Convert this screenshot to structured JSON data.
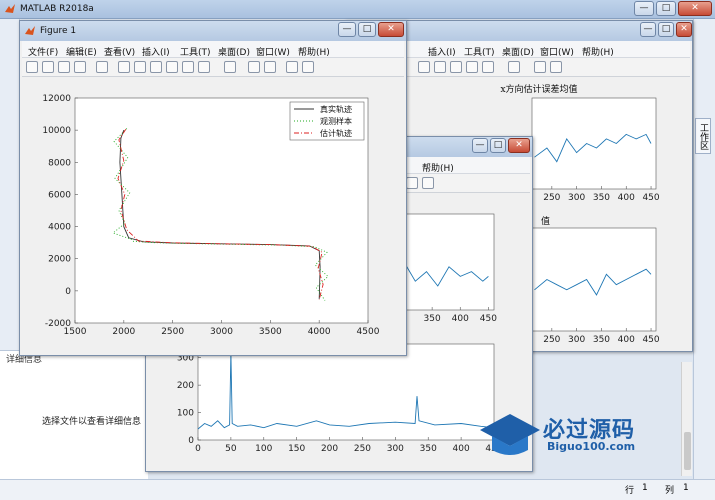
{
  "app": {
    "title": "MATLAB R2018a",
    "right_tab": "工作区",
    "detail_header": "详细信息",
    "detail_text": "选择文件以查看详细信息",
    "status": {
      "row_label": "行",
      "row_value": "1",
      "col_label": "列",
      "col_value": "1"
    },
    "window_controls": [
      "—",
      "□",
      "✕"
    ]
  },
  "menu": [
    "文件(F)",
    "编辑(E)",
    "查看(V)",
    "插入(I)",
    "工具(T)",
    "桌面(D)",
    "窗口(W)",
    "帮助(H)"
  ],
  "menu_help_only": "帮助(H)",
  "figure1": {
    "title": "Figure 1"
  },
  "figure_back": {
    "menu_visible": [
      "插入(I)",
      "工具(T)",
      "桌面(D)",
      "窗口(W)",
      "帮助(H)"
    ],
    "title_fragment": "值"
  },
  "colors": {
    "line_blue": "#1f77b4",
    "true_track": "#333333",
    "observed": "#22aa22",
    "estimate": "#dd2222",
    "watermark": "#1f5fa8"
  },
  "watermark": {
    "cn": "必过源码",
    "en": "Biguo100.com"
  },
  "chart_data": [
    {
      "type": "line",
      "title": "",
      "xlim": [
        1500,
        4500
      ],
      "ylim": [
        -2000,
        12000
      ],
      "xticks": [
        "1500",
        "2000",
        "2500",
        "3000",
        "3500",
        "4000",
        "4500"
      ],
      "yticks": [
        "-2000",
        "0",
        "2000",
        "4000",
        "6000",
        "8000",
        "10000",
        "12000"
      ],
      "legend": {
        "placement": "top-right",
        "entries": [
          "真实轨迹",
          "观测样本",
          "估计轨迹"
        ]
      },
      "series": [
        {
          "name": "真实轨迹",
          "style": "solid",
          "x": [
            2000,
            1970,
            1960,
            1980,
            2000,
            2050,
            2200,
            2500,
            3000,
            3500,
            3900,
            4000,
            4010,
            4005,
            4000
          ],
          "y": [
            10000,
            9500,
            8000,
            6000,
            4000,
            3300,
            3050,
            2980,
            2930,
            2880,
            2800,
            2500,
            1500,
            500,
            -500
          ]
        },
        {
          "name": "观测样本",
          "style": "dotted",
          "x": [
            2030,
            1900,
            2040,
            1910,
            2060,
            1950,
            2010,
            1890,
            2080,
            2100,
            2300,
            2600,
            3100,
            3600,
            3950,
            4080,
            3960,
            4090,
            3970,
            4060
          ],
          "y": [
            10100,
            9300,
            8300,
            7000,
            6100,
            5000,
            4200,
            3600,
            3200,
            3080,
            3000,
            2950,
            2900,
            2850,
            2750,
            2400,
            1600,
            900,
            200,
            -600
          ]
        },
        {
          "name": "估计轨迹",
          "style": "dashdot",
          "x": [
            2020,
            1950,
            2000,
            1940,
            2010,
            1970,
            2030,
            2150,
            2500,
            3000,
            3500,
            3920,
            4030,
            3990,
            4040,
            4000
          ],
          "y": [
            10050,
            9400,
            8100,
            7000,
            6000,
            5000,
            3800,
            3100,
            2990,
            2930,
            2880,
            2780,
            2400,
            1400,
            400,
            -550
          ]
        }
      ]
    },
    {
      "type": "line",
      "title": "x方向估计误差均值",
      "xticks": [
        "250",
        "300",
        "350",
        "400",
        "450"
      ],
      "series": [
        {
          "x": [
            215,
            240,
            260,
            280,
            300,
            320,
            340,
            360,
            380,
            400,
            420,
            440,
            450
          ],
          "y": [
            0.35,
            0.45,
            0.3,
            0.55,
            0.4,
            0.5,
            0.45,
            0.55,
            0.5,
            0.6,
            0.55,
            0.6,
            0.5
          ]
        }
      ]
    },
    {
      "type": "line",
      "title": "值",
      "xticks": [
        "250",
        "300",
        "350",
        "400",
        "450"
      ],
      "series": [
        {
          "x": [
            215,
            240,
            260,
            280,
            300,
            320,
            340,
            360,
            380,
            400,
            420,
            440,
            450
          ],
          "y": [
            0.4,
            0.5,
            0.45,
            0.4,
            0.45,
            0.5,
            0.35,
            0.55,
            0.45,
            0.5,
            0.55,
            0.6,
            0.55
          ]
        }
      ]
    },
    {
      "type": "line",
      "title": "",
      "xticks": [
        "350",
        "400",
        "450"
      ],
      "series": [
        {
          "x": [
            300,
            320,
            340,
            360,
            380,
            400,
            420,
            440,
            450
          ],
          "y": [
            0.5,
            0.3,
            0.4,
            0.25,
            0.45,
            0.35,
            0.4,
            0.3,
            0.35
          ]
        }
      ]
    },
    {
      "type": "line",
      "title": "",
      "xlim": [
        0,
        450
      ],
      "ylim": [
        0,
        350
      ],
      "xticks": [
        "0",
        "50",
        "100",
        "150",
        "200",
        "250",
        "300",
        "350",
        "400",
        "450"
      ],
      "yticks": [
        "0",
        "100",
        "200",
        "300"
      ],
      "series": [
        {
          "x": [
            0,
            10,
            20,
            30,
            40,
            48,
            50,
            52,
            60,
            80,
            100,
            120,
            150,
            180,
            200,
            230,
            260,
            300,
            330,
            333,
            336,
            360,
            400,
            430,
            450
          ],
          "y": [
            40,
            60,
            50,
            70,
            45,
            55,
            320,
            60,
            50,
            55,
            45,
            60,
            50,
            70,
            55,
            50,
            60,
            65,
            60,
            160,
            70,
            55,
            60,
            50,
            45
          ]
        }
      ]
    }
  ]
}
